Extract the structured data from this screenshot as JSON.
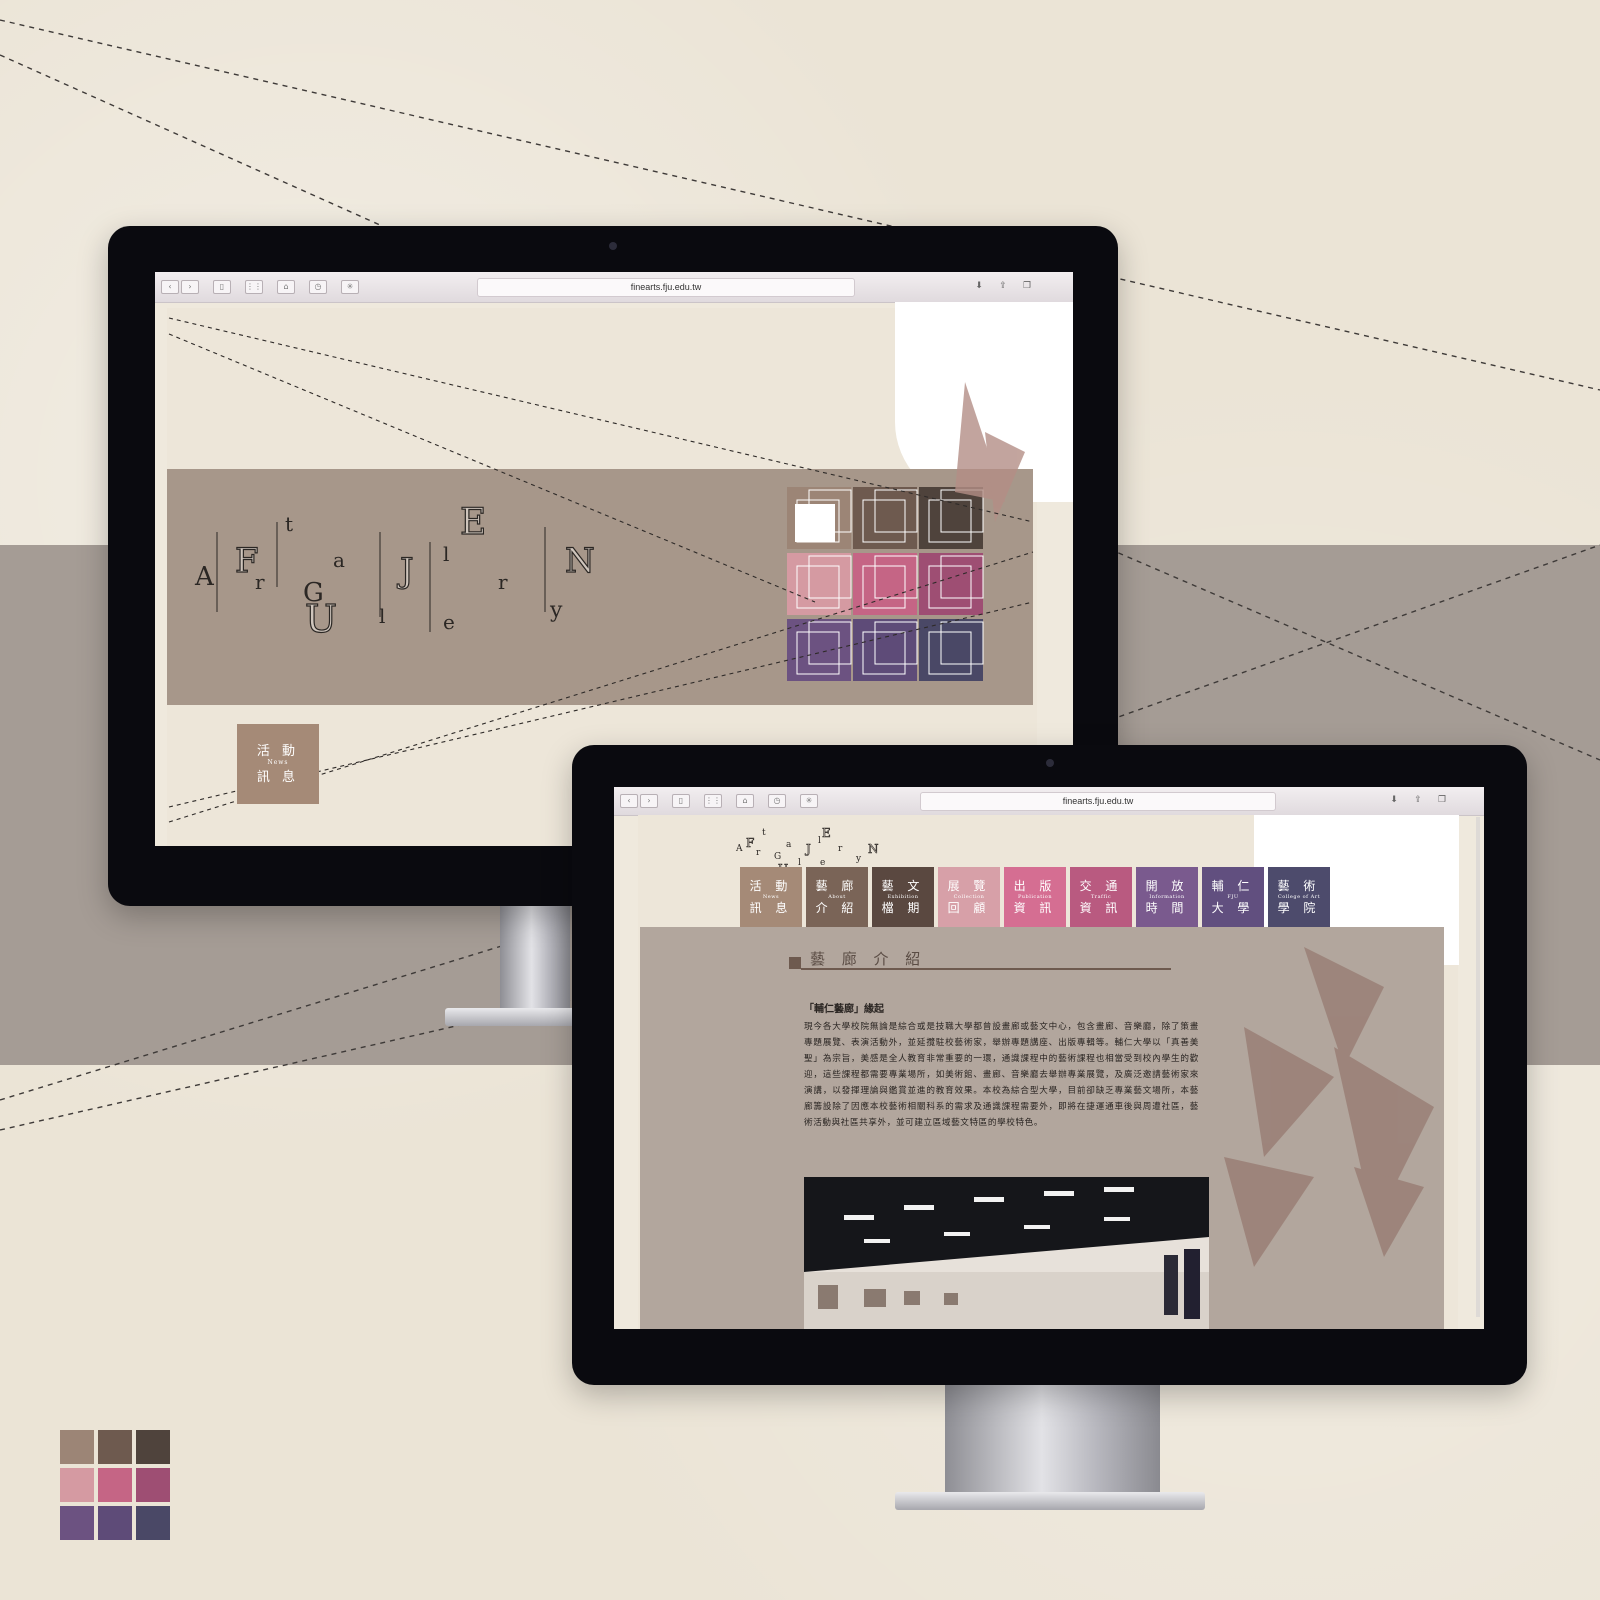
{
  "palette": {
    "row1": [
      "#9c8576",
      "#6e5a4f",
      "#4f433c"
    ],
    "row2": [
      "#d59aa2",
      "#c56585",
      "#9e4e73"
    ],
    "row3": [
      "#6c5281",
      "#5e4b78",
      "#4a4866"
    ]
  },
  "browser": {
    "url": "finearts.fju.edu.tw"
  },
  "home": {
    "title_letters": [
      "A",
      "r",
      "t",
      "G",
      "a",
      "l",
      "l",
      "e",
      "r",
      "y"
    ],
    "logo_blocks": [
      "F",
      "U",
      "J",
      "E",
      "N"
    ],
    "news_button": {
      "top": "活 動",
      "en": "News",
      "bottom": "訊 息"
    }
  },
  "about": {
    "nav": [
      {
        "top": "活 動",
        "en": "News",
        "bottom": "訊 息",
        "color": "#a58a77"
      },
      {
        "top": "藝 廊",
        "en": "About",
        "bottom": "介 紹",
        "color": "#7a6457"
      },
      {
        "top": "藝 文",
        "en": "Exhibition",
        "bottom": "檔 期",
        "color": "#5a4840"
      },
      {
        "top": "展 覽",
        "en": "Collection",
        "bottom": "回 顧",
        "color": "#d7a0a8"
      },
      {
        "top": "出 版",
        "en": "Publication",
        "bottom": "資 訊",
        "color": "#d56e92"
      },
      {
        "top": "交 通",
        "en": "Traffic",
        "bottom": "資 訊",
        "color": "#b95a80"
      },
      {
        "top": "開 放",
        "en": "Information",
        "bottom": "時 間",
        "color": "#7a5a8e"
      },
      {
        "top": "輔 仁",
        "en": "FJU",
        "bottom": "大 學",
        "color": "#614f7f"
      },
      {
        "top": "藝 術",
        "en": "College of Art",
        "bottom": "學 院",
        "color": "#4d4b6c"
      }
    ],
    "heading": "藝 廊 介 紹",
    "para_title": "「輔仁藝廊」緣起",
    "para_text": "現今各大學校院無論是綜合或是技職大學都曾設畫廊或藝文中心，包含畫廊、音樂廳，除了策畫專題展覽、表演活動外，並延攬駐校藝術家，舉辦專題講座、出版專輯等。輔仁大學以「真善美聖」為宗旨，美感是全人教育非常重要的一環，通識課程中的藝術課程也相當受到校內學生的歡迎，這些課程都需要專業場所，如美術館、畫廊、音樂廳去舉辦專業展覽，及廣泛邀請藝術家來演講，以發揮理論與鑑賞並進的教育效果。本校為綜合型大學，目前卻缺乏專業藝文場所，本藝廊籌設除了因應本校藝術相關科系的需求及通識課程需要外，即將在捷運通車後與周遭社區，藝術活動與社區共享外，並可建立區域藝文特區的學校特色。"
  }
}
